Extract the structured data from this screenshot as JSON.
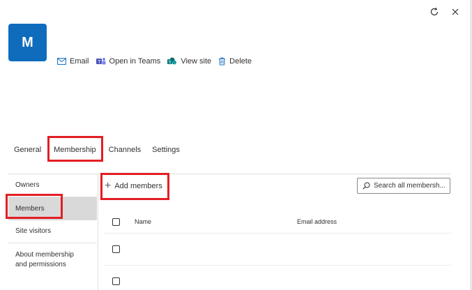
{
  "window": {
    "refresh_icon": "refresh-icon",
    "close_icon": "close-icon"
  },
  "group": {
    "avatar_letter": "M"
  },
  "actions": [
    {
      "label": "Email",
      "icon": "mail-icon"
    },
    {
      "label": "Open in Teams",
      "icon": "teams-icon"
    },
    {
      "label": "View site",
      "icon": "sharepoint-icon"
    },
    {
      "label": "Delete",
      "icon": "trash-icon"
    }
  ],
  "tabs": [
    {
      "label": "General"
    },
    {
      "label": "Membership",
      "selected": true
    },
    {
      "label": "Channels"
    },
    {
      "label": "Settings"
    }
  ],
  "nav": {
    "items": [
      {
        "label": "Owners"
      },
      {
        "label": "Members",
        "selected": true
      },
      {
        "label": "Site visitors"
      },
      {
        "label": "About membership and permissions"
      }
    ]
  },
  "toolbar": {
    "add_label": "Add members"
  },
  "search": {
    "placeholder": "Search all membersh..."
  },
  "table": {
    "columns": [
      "Name",
      "Email address"
    ],
    "rows": 2
  },
  "colors": {
    "avatar": "#0f6cbd",
    "highlight": "#e31e24"
  }
}
